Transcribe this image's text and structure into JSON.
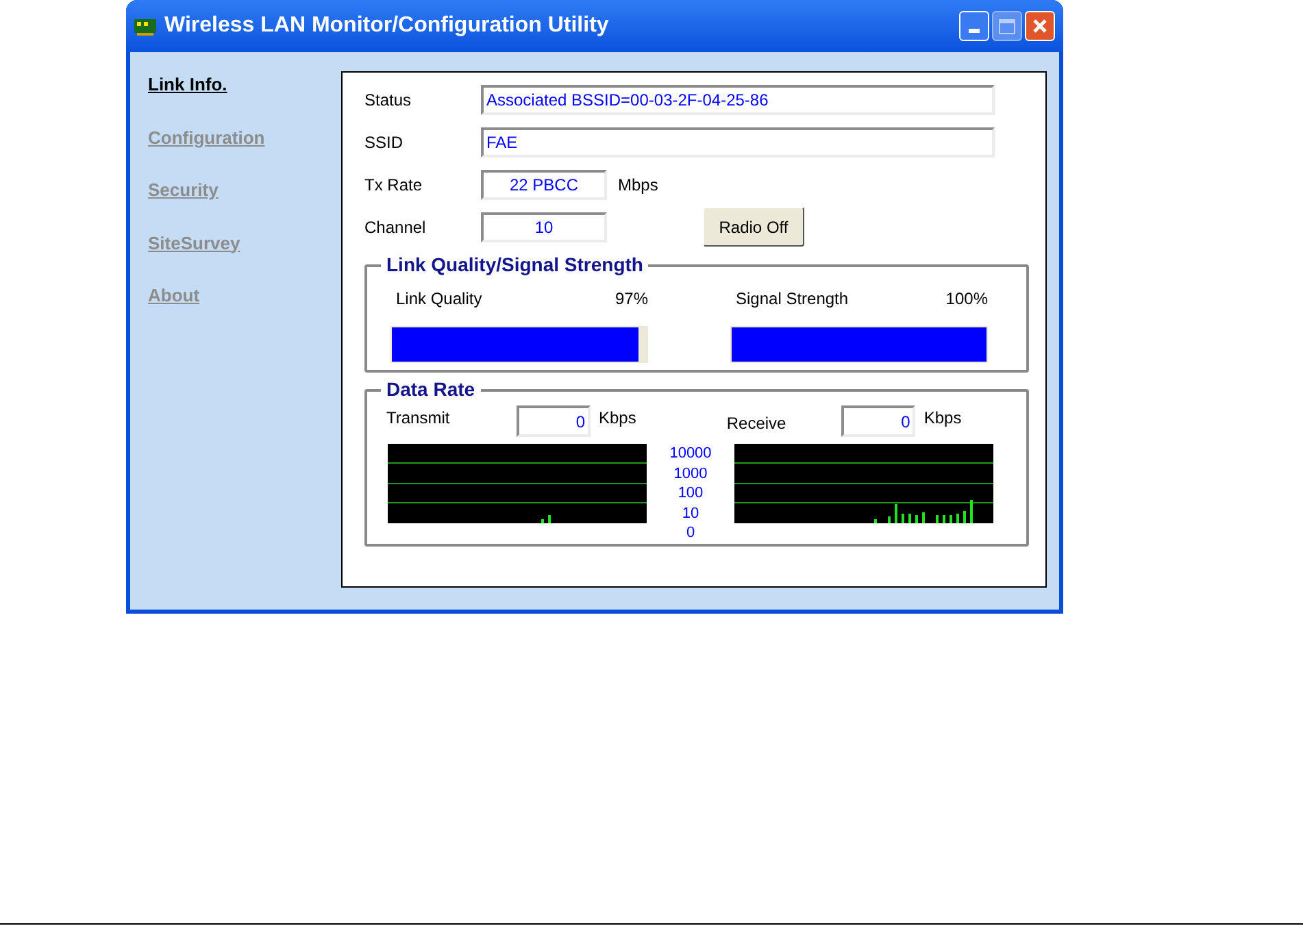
{
  "window": {
    "title": "Wireless LAN Monitor/Configuration Utility"
  },
  "sidebar": {
    "items": [
      {
        "label": "Link Info.",
        "selected": true
      },
      {
        "label": "Configuration",
        "selected": false
      },
      {
        "label": "Security",
        "selected": false
      },
      {
        "label": "SiteSurvey",
        "selected": false
      },
      {
        "label": "About",
        "selected": false
      }
    ]
  },
  "link_info": {
    "status": {
      "label": "Status",
      "value": "Associated BSSID=00-03-2F-04-25-86"
    },
    "ssid": {
      "label": "SSID",
      "value": "FAE"
    },
    "tx_rate": {
      "label": "Tx Rate",
      "value": "22 PBCC",
      "unit": "Mbps"
    },
    "channel": {
      "label": "Channel",
      "value": "10"
    },
    "radio_button": "Radio Off"
  },
  "link_quality_group": {
    "title": "Link Quality/Signal Strength",
    "meters": [
      {
        "label": "Link Quality",
        "reading": "97%",
        "level": 0.97
      },
      {
        "label": "Signal Strength",
        "reading": "100%",
        "level": 1.0
      }
    ]
  },
  "data_rate_group": {
    "title": "Data Rate",
    "transmit": {
      "label": "Transmit",
      "value": "0",
      "unit": "Kbps"
    },
    "receive": {
      "label": "Receive",
      "value": "0",
      "unit": "Kbps"
    },
    "scale_labels": [
      "10000",
      "1000",
      "100",
      "10",
      "0"
    ]
  }
}
